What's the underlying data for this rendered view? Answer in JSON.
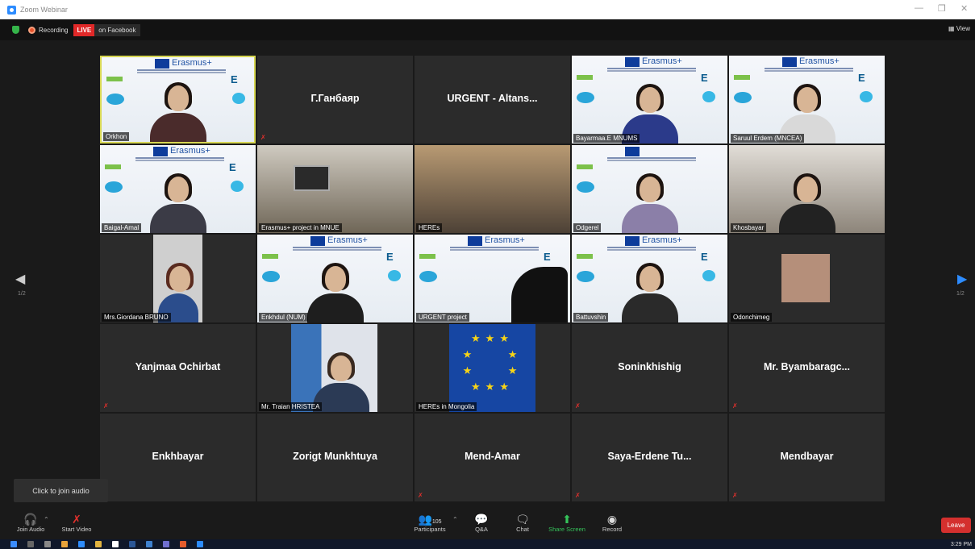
{
  "window": {
    "title": "Zoom Webinar"
  },
  "topbar": {
    "recording": "Recording",
    "live": "LIVE",
    "destination": "on Facebook",
    "view": "View"
  },
  "tiles": [
    {
      "label": "Orkhon"
    },
    {
      "name": "Г.Ганбаяр"
    },
    {
      "name": "URGENT - Altans..."
    },
    {
      "label": "Bayarmaa.E MNUMS"
    },
    {
      "label": "Saruul Erdem (MNCEA)"
    },
    {
      "label": "Baigal-Amal"
    },
    {
      "label": "Erasmus+ project in MNUE"
    },
    {
      "label": "HEREs"
    },
    {
      "label": "Odgerel"
    },
    {
      "label": "Khosbayar"
    },
    {
      "label": "Mrs.Giordana BRUNO"
    },
    {
      "label": "Enkhdul (NUM)"
    },
    {
      "label": "URGENT project"
    },
    {
      "label": "Battuvshin"
    },
    {
      "label": "Odonchimeg"
    },
    {
      "name": "Yanjmaa Ochirbat"
    },
    {
      "label": "Mr. Traian HRISTEA"
    },
    {
      "label": "HEREs in Mongolia"
    },
    {
      "name": "Soninkhishig"
    },
    {
      "name": "Mr. Byambaragc..."
    },
    {
      "name": "Enkhbayar"
    },
    {
      "name": "Zorigt Munkhtuya"
    },
    {
      "name": "Mend-Amar"
    },
    {
      "name": "Saya-Erdene Tu..."
    },
    {
      "name": "Mendbayar"
    }
  ],
  "poster": {
    "title": "Erasmus+"
  },
  "paging": {
    "left": "1/2",
    "right": "1/2"
  },
  "tooltip": "Click to join audio",
  "toolbar": {
    "join_audio": "Join Audio",
    "start_video": "Start Video",
    "participants": "Participants",
    "participants_count": "105",
    "qa": "Q&A",
    "chat": "Chat",
    "share_screen": "Share Screen",
    "record": "Record",
    "leave": "Leave"
  },
  "taskbar": {
    "time": "3:29 PM"
  }
}
